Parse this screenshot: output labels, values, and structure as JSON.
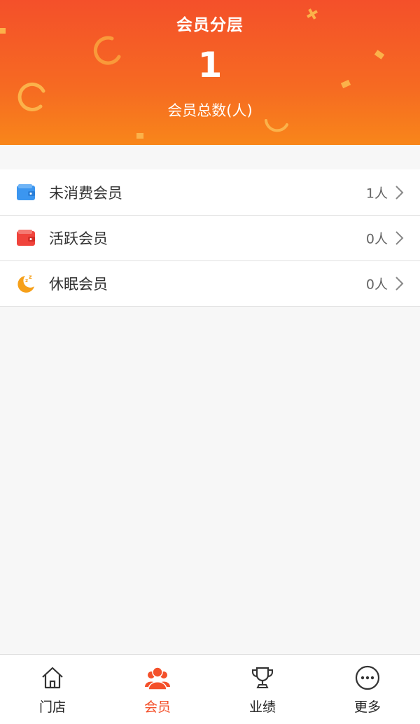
{
  "header": {
    "title": "会员分层",
    "count": "1",
    "subtitle": "会员总数(人)"
  },
  "list": {
    "items": [
      {
        "icon": "wallet-blue-icon",
        "label": "未消费会员",
        "value": "1人"
      },
      {
        "icon": "wallet-red-icon",
        "label": "活跃会员",
        "value": "0人"
      },
      {
        "icon": "moon-sleep-icon",
        "label": "休眠会员",
        "value": "0人"
      }
    ]
  },
  "tabbar": {
    "active": "会员",
    "tabs": [
      {
        "icon": "home-icon",
        "label": "门店"
      },
      {
        "icon": "members-icon",
        "label": "会员"
      },
      {
        "icon": "trophy-icon",
        "label": "业绩"
      },
      {
        "icon": "more-icon",
        "label": "更多"
      }
    ]
  },
  "colors": {
    "accent": "#f4502a",
    "header_bottom": "#f8861a",
    "wallet_blue": "#3b96f0",
    "wallet_red": "#f0443c",
    "moon_orange": "#f6a01a"
  }
}
